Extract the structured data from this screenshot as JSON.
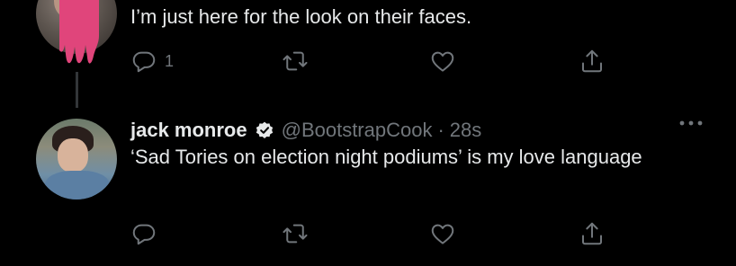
{
  "tweets": [
    {
      "text": "I’m just here for the look on their faces.",
      "actions": {
        "reply_count": "1"
      }
    },
    {
      "name": "jack monroe",
      "handle": "@BootstrapCook",
      "separator": "·",
      "time": "28s",
      "text": "‘Sad Tories on election night podiums’ is my love language",
      "actions": {}
    }
  ],
  "icons": {
    "reply": "reply-icon",
    "retweet": "retweet-icon",
    "like": "heart-icon",
    "share": "share-icon",
    "more": "more-icon",
    "verified": "verified-badge-icon"
  },
  "colors": {
    "background": "#000000",
    "primary_text": "#e7e9ea",
    "secondary_text": "#71767b",
    "pink_accent": "#e0457b"
  }
}
